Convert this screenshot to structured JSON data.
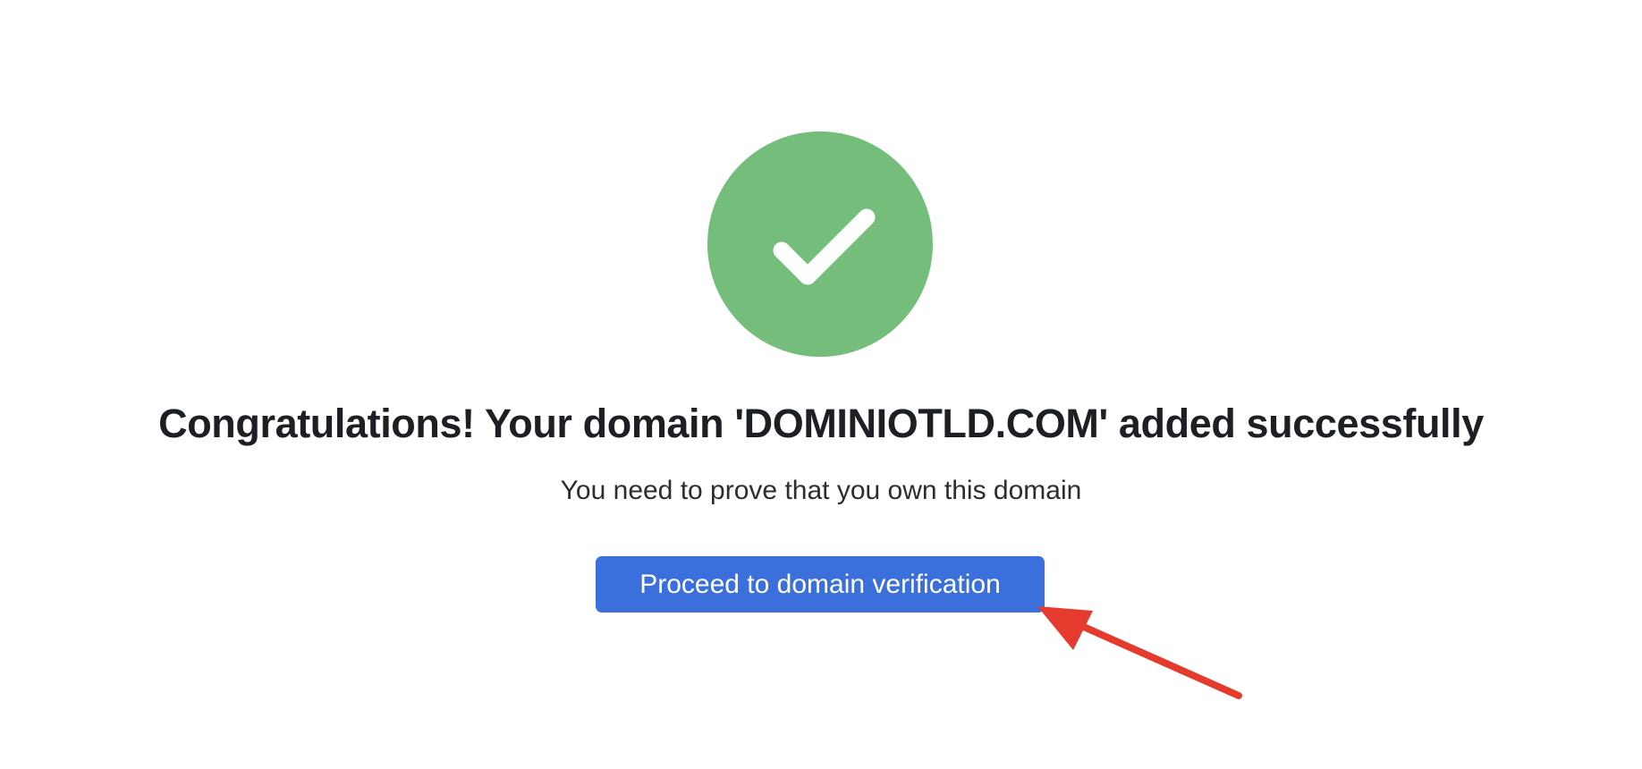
{
  "success": {
    "icon": "checkmark-circle-icon",
    "icon_color": "#74bd7a",
    "headline": "Congratulations! Your domain 'DOMINIOTLD.COM' added successfully",
    "subtext": "You need to prove that you own this domain"
  },
  "actions": {
    "proceed_label": "Proceed to domain verification",
    "proceed_color": "#3b6fdb"
  },
  "annotation": {
    "icon": "red-arrow-icon",
    "color": "#e53a2e"
  }
}
